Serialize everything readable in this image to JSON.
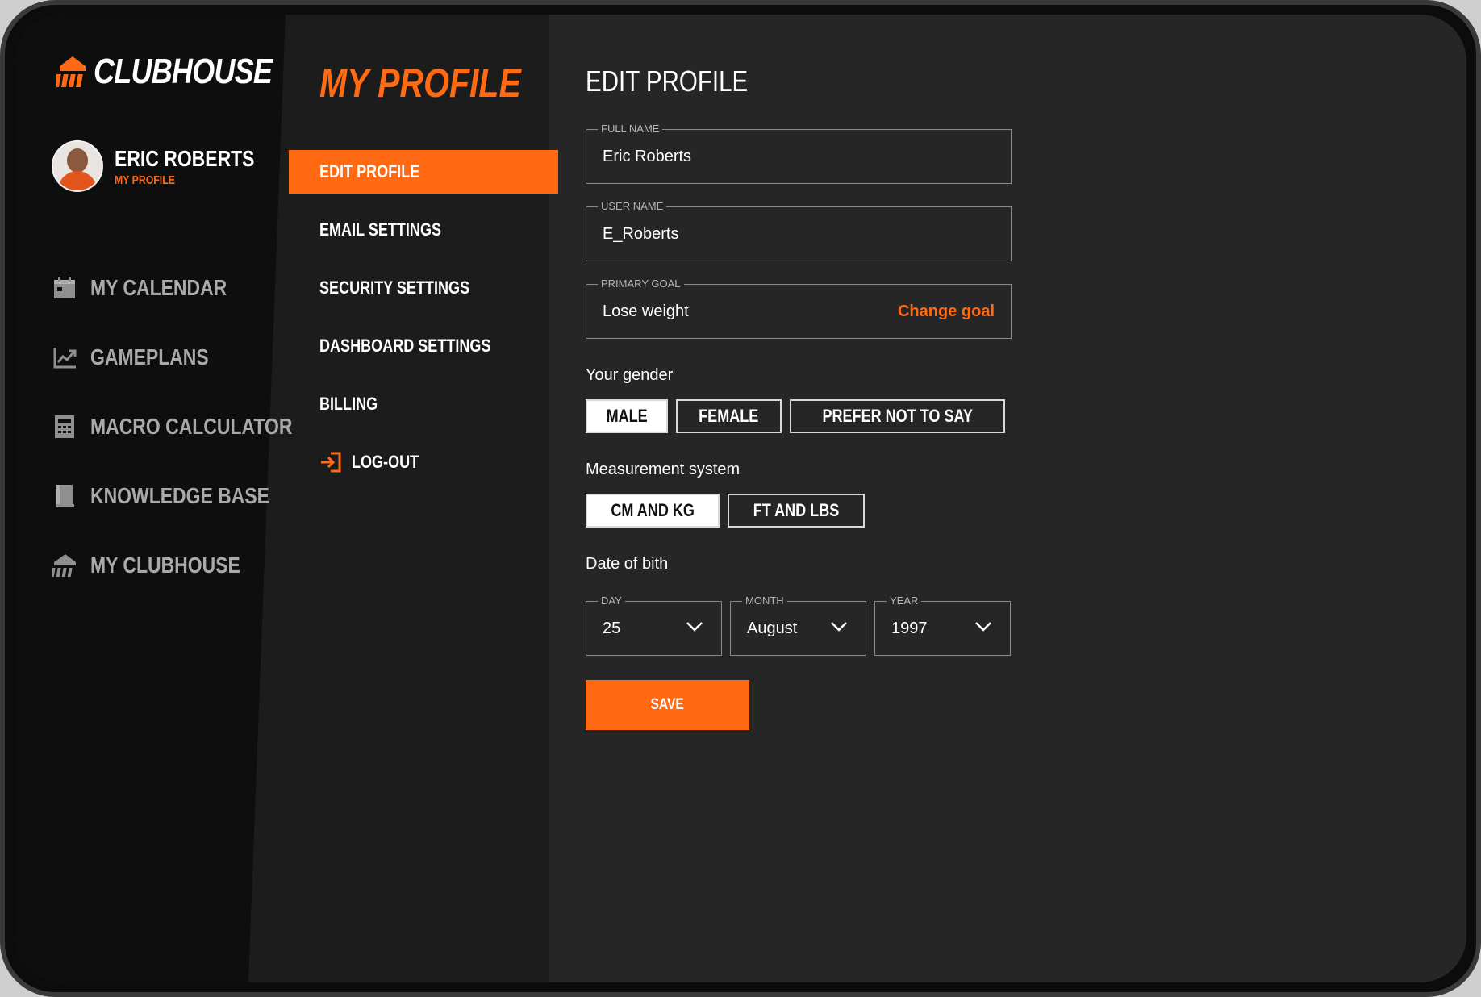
{
  "brand": {
    "name": "CLUBHOUSE",
    "accent_color": "#ff6a13"
  },
  "user": {
    "name": "ERIC ROBERTS",
    "subtitle": "MY PROFILE"
  },
  "sidebar": {
    "items": [
      {
        "label": "MY CALENDAR",
        "icon": "calendar-icon"
      },
      {
        "label": "GAMEPLANS",
        "icon": "chart-line-icon"
      },
      {
        "label": "MACRO CALCULATOR",
        "icon": "calculator-icon"
      },
      {
        "label": "KNOWLEDGE BASE",
        "icon": "book-icon"
      },
      {
        "label": "MY CLUBHOUSE",
        "icon": "clubhouse-icon"
      }
    ]
  },
  "profile_menu": {
    "heading": "MY PROFILE",
    "items": [
      {
        "label": "EDIT PROFILE",
        "active": true
      },
      {
        "label": "EMAIL SETTINGS"
      },
      {
        "label": "SECURITY SETTINGS"
      },
      {
        "label": "DASHBOARD SETTINGS"
      },
      {
        "label": "BILLING"
      },
      {
        "label": "LOG-OUT",
        "icon": "logout-icon"
      }
    ]
  },
  "form": {
    "title": "EDIT PROFILE",
    "full_name": {
      "label": "FULL NAME",
      "value": "Eric Roberts"
    },
    "user_name": {
      "label": "USER NAME",
      "value": "E_Roberts"
    },
    "primary_goal": {
      "label": "PRIMARY GOAL",
      "value": "Lose weight",
      "action": "Change goal"
    },
    "gender": {
      "label": "Your gender",
      "options": [
        "MALE",
        "FEMALE",
        "PREFER NOT TO SAY"
      ],
      "selected": "MALE"
    },
    "measurement": {
      "label": "Measurement system",
      "options": [
        "CM AND KG",
        "FT AND LBS"
      ],
      "selected": "CM AND KG"
    },
    "dob": {
      "label": "Date of bith",
      "day": {
        "label": "DAY",
        "value": "25"
      },
      "month": {
        "label": "MONTH",
        "value": "August"
      },
      "year": {
        "label": "YEAR",
        "value": "1997"
      }
    },
    "save_label": "SAVE"
  }
}
